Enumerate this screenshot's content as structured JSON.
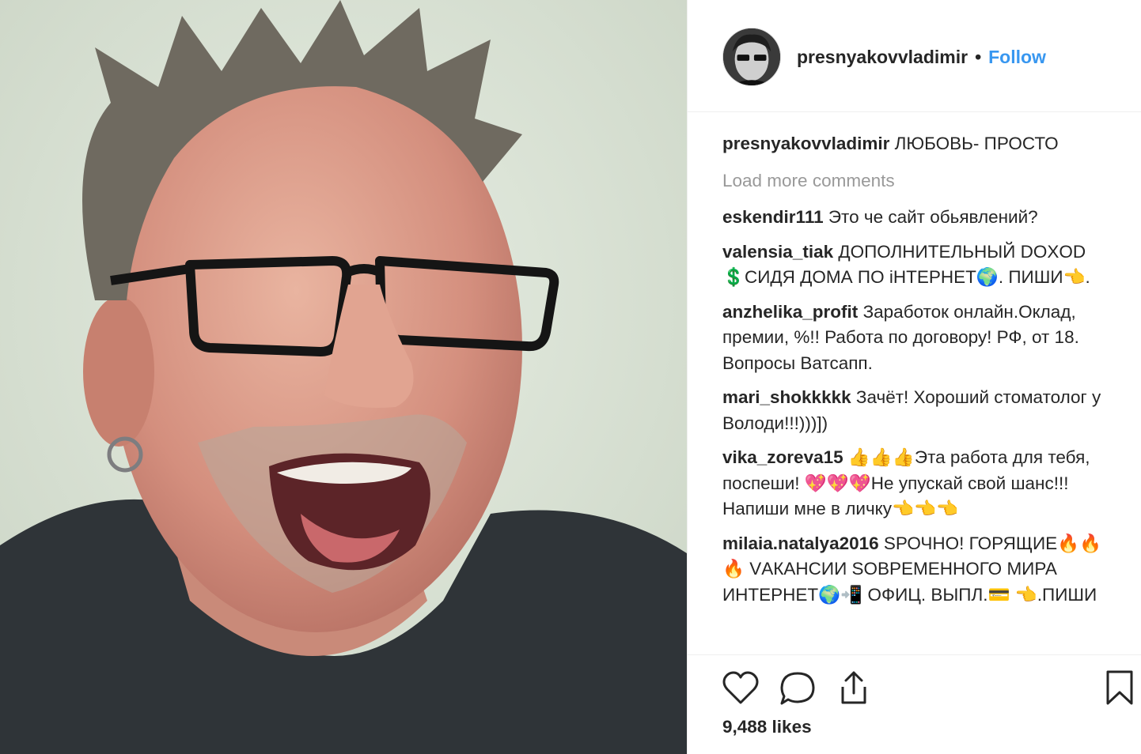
{
  "post": {
    "author": "presnyakovvladimir",
    "separator": "•",
    "follow_label": "Follow",
    "photo_subject": "selfie-photo",
    "caption_text": "ЛЮБОВЬ- ПРОСТО",
    "load_more_label": "Load more comments",
    "comments": [
      {
        "user": "eskendir111",
        "text": "Это че сайт обьявлений?"
      },
      {
        "user": "valensia_tiak",
        "text": "ДОПОЛНИТЕЛЬНЫЙ DOXOD 💲СИДЯ ДОМА ПО іНТЕРНЕТ🌍. ПИШИ👈."
      },
      {
        "user": "anzhelika_profit",
        "text": "Заработок онлайн.Оклад, премии, %!! Работа по договору! РФ, от 18. Вопросы Ватсапп."
      },
      {
        "user": "mari_shokkkkk",
        "text": "Зачёт! Хороший стоматолог у Володи!!!)))])"
      },
      {
        "user": "vika_zoreva15",
        "text": "👍👍👍Эта работа для тебя, поспеши! 💖💖💖Не упускай свой шанс!!! Напиши мне в личку👈👈👈"
      },
      {
        "user": "milaia.natalya2016",
        "text": "SРОЧНО! ГОРЯЩИЕ🔥🔥🔥 VАКАНСИИ SОВРЕМЕННОГО МИРА ИНТЕРНЕТ🌍📲 ОФИЦ. ВЫПЛ.💳 👈.ПИШИ"
      }
    ],
    "likes_label": "9,488 likes"
  },
  "icons": {
    "like": "heart-icon",
    "comment": "comment-icon",
    "share": "share-icon",
    "save": "bookmark-icon"
  },
  "colors": {
    "link": "#3897f0",
    "text": "#262626",
    "muted": "#999999",
    "divider": "#efefef"
  }
}
